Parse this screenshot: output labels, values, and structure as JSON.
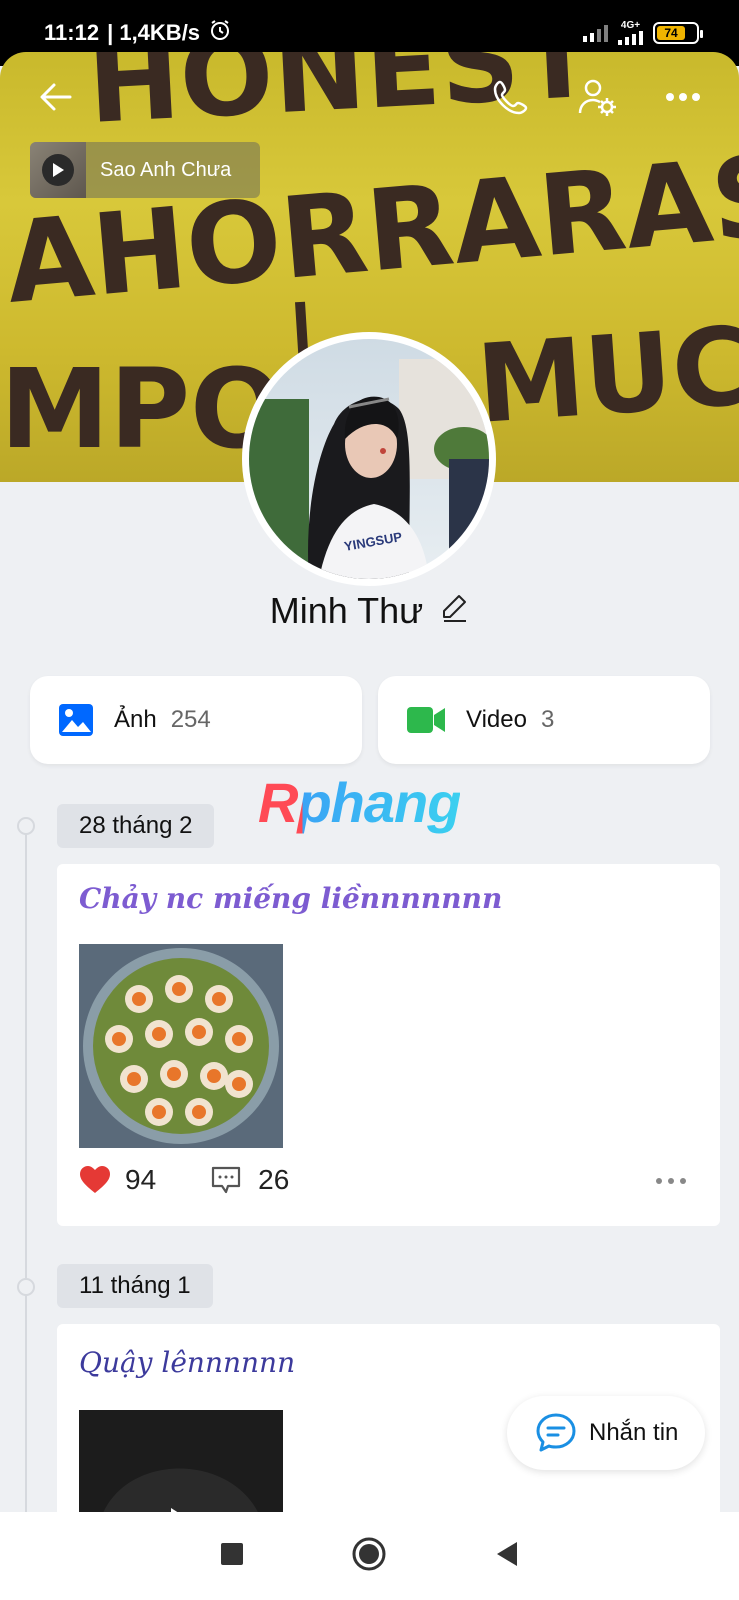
{
  "status_bar": {
    "time": "11:12",
    "network_speed": "| 1,4KB/s",
    "network_type": "4G+",
    "battery_level": "74"
  },
  "header": {
    "music": {
      "title": "Sao Anh Chưa"
    }
  },
  "cover_text": [
    "HONEST",
    "AHORRARAS",
    "MPO",
    "MUCH"
  ],
  "profile": {
    "name": "Minh Thư"
  },
  "media": {
    "photos": {
      "label": "Ảnh",
      "count": "254"
    },
    "videos": {
      "label": "Video",
      "count": "3"
    }
  },
  "watermark": "Rphang",
  "timeline": [
    {
      "date": "28 tháng 2",
      "caption": "Chảy nc miếng liềnnnnnnn",
      "likes": "94",
      "comments": "26"
    },
    {
      "date": "11 tháng 1",
      "caption": "Quậy lênnnnnn"
    }
  ],
  "message_button": {
    "label": "Nhắn tin"
  },
  "colors": {
    "accent": "#0068ff",
    "video_green": "#2db84c",
    "heart_red": "#e53935",
    "caption_purple": "#7d5cd1"
  },
  "icons": [
    "back-arrow-icon",
    "phone-icon",
    "user-settings-icon",
    "more-icon",
    "play-icon",
    "edit-pencil-icon",
    "photo-icon",
    "video-camera-icon",
    "heart-icon",
    "comment-icon",
    "chat-icon",
    "square-icon",
    "home-circle-icon",
    "back-triangle-icon"
  ]
}
